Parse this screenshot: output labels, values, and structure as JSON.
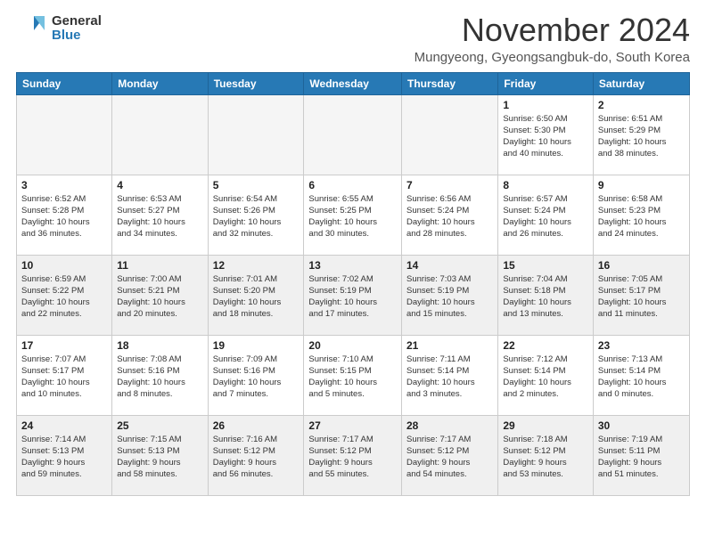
{
  "header": {
    "logo_line1": "General",
    "logo_line2": "Blue",
    "month_title": "November 2024",
    "subtitle": "Mungyeong, Gyeongsangbuk-do, South Korea"
  },
  "weekdays": [
    "Sunday",
    "Monday",
    "Tuesday",
    "Wednesday",
    "Thursday",
    "Friday",
    "Saturday"
  ],
  "weeks": [
    [
      {
        "day": "",
        "info": ""
      },
      {
        "day": "",
        "info": ""
      },
      {
        "day": "",
        "info": ""
      },
      {
        "day": "",
        "info": ""
      },
      {
        "day": "",
        "info": ""
      },
      {
        "day": "1",
        "info": "Sunrise: 6:50 AM\nSunset: 5:30 PM\nDaylight: 10 hours\nand 40 minutes."
      },
      {
        "day": "2",
        "info": "Sunrise: 6:51 AM\nSunset: 5:29 PM\nDaylight: 10 hours\nand 38 minutes."
      }
    ],
    [
      {
        "day": "3",
        "info": "Sunrise: 6:52 AM\nSunset: 5:28 PM\nDaylight: 10 hours\nand 36 minutes."
      },
      {
        "day": "4",
        "info": "Sunrise: 6:53 AM\nSunset: 5:27 PM\nDaylight: 10 hours\nand 34 minutes."
      },
      {
        "day": "5",
        "info": "Sunrise: 6:54 AM\nSunset: 5:26 PM\nDaylight: 10 hours\nand 32 minutes."
      },
      {
        "day": "6",
        "info": "Sunrise: 6:55 AM\nSunset: 5:25 PM\nDaylight: 10 hours\nand 30 minutes."
      },
      {
        "day": "7",
        "info": "Sunrise: 6:56 AM\nSunset: 5:24 PM\nDaylight: 10 hours\nand 28 minutes."
      },
      {
        "day": "8",
        "info": "Sunrise: 6:57 AM\nSunset: 5:24 PM\nDaylight: 10 hours\nand 26 minutes."
      },
      {
        "day": "9",
        "info": "Sunrise: 6:58 AM\nSunset: 5:23 PM\nDaylight: 10 hours\nand 24 minutes."
      }
    ],
    [
      {
        "day": "10",
        "info": "Sunrise: 6:59 AM\nSunset: 5:22 PM\nDaylight: 10 hours\nand 22 minutes."
      },
      {
        "day": "11",
        "info": "Sunrise: 7:00 AM\nSunset: 5:21 PM\nDaylight: 10 hours\nand 20 minutes."
      },
      {
        "day": "12",
        "info": "Sunrise: 7:01 AM\nSunset: 5:20 PM\nDaylight: 10 hours\nand 18 minutes."
      },
      {
        "day": "13",
        "info": "Sunrise: 7:02 AM\nSunset: 5:19 PM\nDaylight: 10 hours\nand 17 minutes."
      },
      {
        "day": "14",
        "info": "Sunrise: 7:03 AM\nSunset: 5:19 PM\nDaylight: 10 hours\nand 15 minutes."
      },
      {
        "day": "15",
        "info": "Sunrise: 7:04 AM\nSunset: 5:18 PM\nDaylight: 10 hours\nand 13 minutes."
      },
      {
        "day": "16",
        "info": "Sunrise: 7:05 AM\nSunset: 5:17 PM\nDaylight: 10 hours\nand 11 minutes."
      }
    ],
    [
      {
        "day": "17",
        "info": "Sunrise: 7:07 AM\nSunset: 5:17 PM\nDaylight: 10 hours\nand 10 minutes."
      },
      {
        "day": "18",
        "info": "Sunrise: 7:08 AM\nSunset: 5:16 PM\nDaylight: 10 hours\nand 8 minutes."
      },
      {
        "day": "19",
        "info": "Sunrise: 7:09 AM\nSunset: 5:16 PM\nDaylight: 10 hours\nand 7 minutes."
      },
      {
        "day": "20",
        "info": "Sunrise: 7:10 AM\nSunset: 5:15 PM\nDaylight: 10 hours\nand 5 minutes."
      },
      {
        "day": "21",
        "info": "Sunrise: 7:11 AM\nSunset: 5:14 PM\nDaylight: 10 hours\nand 3 minutes."
      },
      {
        "day": "22",
        "info": "Sunrise: 7:12 AM\nSunset: 5:14 PM\nDaylight: 10 hours\nand 2 minutes."
      },
      {
        "day": "23",
        "info": "Sunrise: 7:13 AM\nSunset: 5:14 PM\nDaylight: 10 hours\nand 0 minutes."
      }
    ],
    [
      {
        "day": "24",
        "info": "Sunrise: 7:14 AM\nSunset: 5:13 PM\nDaylight: 9 hours\nand 59 minutes."
      },
      {
        "day": "25",
        "info": "Sunrise: 7:15 AM\nSunset: 5:13 PM\nDaylight: 9 hours\nand 58 minutes."
      },
      {
        "day": "26",
        "info": "Sunrise: 7:16 AM\nSunset: 5:12 PM\nDaylight: 9 hours\nand 56 minutes."
      },
      {
        "day": "27",
        "info": "Sunrise: 7:17 AM\nSunset: 5:12 PM\nDaylight: 9 hours\nand 55 minutes."
      },
      {
        "day": "28",
        "info": "Sunrise: 7:17 AM\nSunset: 5:12 PM\nDaylight: 9 hours\nand 54 minutes."
      },
      {
        "day": "29",
        "info": "Sunrise: 7:18 AM\nSunset: 5:12 PM\nDaylight: 9 hours\nand 53 minutes."
      },
      {
        "day": "30",
        "info": "Sunrise: 7:19 AM\nSunset: 5:11 PM\nDaylight: 9 hours\nand 51 minutes."
      }
    ]
  ]
}
